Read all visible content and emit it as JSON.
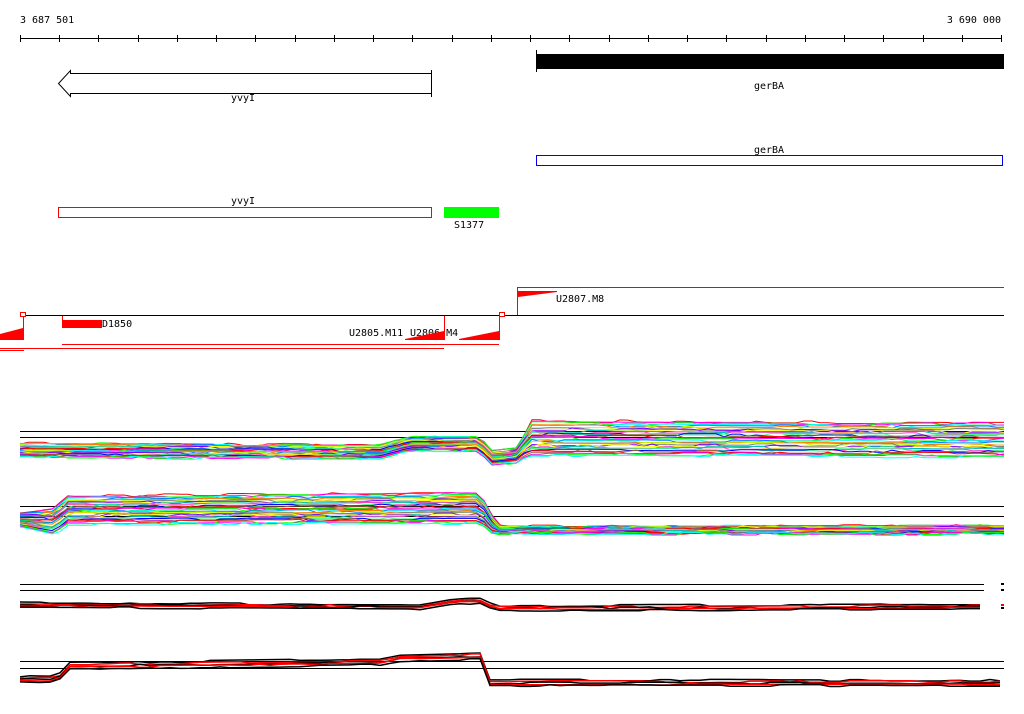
{
  "ruler": {
    "start_label": "3 687 501",
    "end_label": "3 690 000",
    "tick_count": 26
  },
  "genes": {
    "yvyI_top": {
      "label": "yvyI",
      "strand": "reverse"
    },
    "gerBA_top": {
      "label": "gerBA"
    },
    "gerBA_annot": {
      "label": "gerBA"
    },
    "yvyI_annot": {
      "label": "yvyI"
    },
    "S1377": {
      "label": "S1377"
    }
  },
  "segments": {
    "U2807_M8": "U2807.M8",
    "D1850": "D1850",
    "U2805_M11": "U2805.M11",
    "U2806_M4": "U2806.M4"
  },
  "colors": {
    "gene_fill": "#000000",
    "annot_blue": "#0000ff",
    "annot_red": "#ff0000",
    "s_green": "#00ff00",
    "segment_red": "#ff0000"
  }
}
